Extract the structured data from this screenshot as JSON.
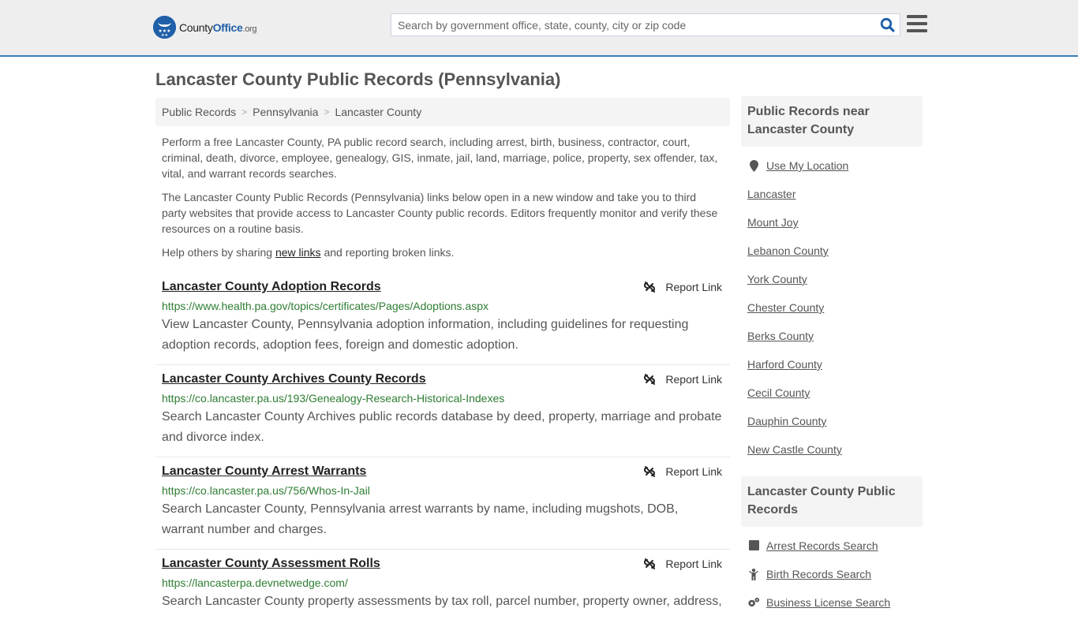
{
  "header": {
    "logo": {
      "name_part1": "County",
      "name_part2": "Office",
      "name_part3": ".org"
    },
    "search": {
      "placeholder": "Search by government office, state, county, city or zip code",
      "value": ""
    },
    "colors": {
      "brand": "#1f5fa8",
      "accent_border": "#3a7db5",
      "header_bg": "#eeeeee"
    }
  },
  "page": {
    "title": "Lancaster County Public Records (Pennsylvania)",
    "breadcrumb": [
      {
        "label": "Public Records"
      },
      {
        "label": "Pennsylvania"
      },
      {
        "label": "Lancaster County"
      }
    ],
    "intro": {
      "p1": "Perform a free Lancaster County, PA public record search, including arrest, birth, business, contractor, court, criminal, death, divorce, employee, genealogy, GIS, inmate, jail, land, marriage, police, property, sex offender, tax, vital, and warrant records searches.",
      "p2": "The Lancaster County Public Records (Pennsylvania) links below open in a new window and take you to third party websites that provide access to Lancaster County public records. Editors frequently monitor and verify these resources on a routine basis.",
      "p3_before": "Help others by sharing ",
      "p3_link": "new links",
      "p3_after": " and reporting broken links."
    },
    "report_label": "Report Link",
    "records": [
      {
        "title": "Lancaster County Adoption Records",
        "url": "https://www.health.pa.gov/topics/certificates/Pages/Adoptions.aspx",
        "description": "View Lancaster County, Pennsylvania adoption information, including guidelines for requesting adoption records, adoption fees, foreign and domestic adoption."
      },
      {
        "title": "Lancaster County Archives County Records",
        "url": "https://co.lancaster.pa.us/193/Genealogy-Research-Historical-Indexes",
        "description": "Search Lancaster County Archives public records database by deed, property, marriage and probate and divorce index."
      },
      {
        "title": "Lancaster County Arrest Warrants",
        "url": "https://co.lancaster.pa.us/756/Whos-In-Jail",
        "description": "Search Lancaster County, Pennsylvania arrest warrants by name, including mugshots, DOB, warrant number and charges."
      },
      {
        "title": "Lancaster County Assessment Rolls",
        "url": "https://lancasterpa.devnetwedge.com/",
        "description": "Search Lancaster County property assessments by tax roll, parcel number, property owner, address,"
      }
    ]
  },
  "sidebar": {
    "nearby": {
      "heading": "Public Records near Lancaster County",
      "use_location": "Use My Location",
      "places": [
        "Lancaster",
        "Mount Joy",
        "Lebanon County",
        "York County",
        "Chester County",
        "Berks County",
        "Harford County",
        "Cecil County",
        "Dauphin County",
        "New Castle County"
      ]
    },
    "county_records": {
      "heading": "Lancaster County Public Records",
      "items": [
        {
          "label": "Arrest Records Search",
          "icon": "square-icon"
        },
        {
          "label": "Birth Records Search",
          "icon": "child-icon"
        },
        {
          "label": "Business License Search",
          "icon": "gears-icon"
        }
      ]
    }
  }
}
